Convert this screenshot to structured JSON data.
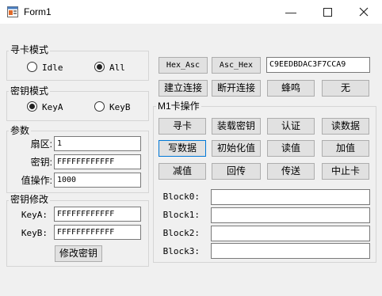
{
  "window": {
    "title": "Form1"
  },
  "search_mode": {
    "label": "寻卡模式",
    "options": [
      "Idle",
      "All"
    ],
    "selected": "All"
  },
  "key_mode": {
    "label": "密钥模式",
    "options": [
      "KeyA",
      "KeyB"
    ],
    "selected": "KeyA"
  },
  "params": {
    "label": "参数",
    "sector_label": "扇区:",
    "sector_value": "1",
    "key_label": "密钥:",
    "key_value": "FFFFFFFFFFFF",
    "valop_label": "值操作:",
    "valop_value": "1000"
  },
  "key_modify": {
    "label": "密钥修改",
    "keya_label": "KeyA:",
    "keya_value": "FFFFFFFFFFFF",
    "keyb_label": "KeyB:",
    "keyb_value": "FFFFFFFFFFFF",
    "modify_button": "修改密钥"
  },
  "top_buttons": {
    "hex_asc": "Hex_Asc",
    "asc_hex": "Asc_Hex",
    "convert_value": "C9EEDBDAC3F7CCA9"
  },
  "conn_buttons": {
    "connect": "建立连接",
    "disconnect": "断开连接",
    "beep": "蜂鸣",
    "none": "无"
  },
  "m1": {
    "label": "M1卡操作",
    "buttons": [
      "寻卡",
      "装载密钥",
      "认证",
      "读数据",
      "写数据",
      "初始化值",
      "读值",
      "加值",
      "减值",
      "回传",
      "传送",
      "中止卡"
    ],
    "blocks": [
      {
        "label": "Block0:",
        "value": ""
      },
      {
        "label": "Block1:",
        "value": ""
      },
      {
        "label": "Block2:",
        "value": ""
      },
      {
        "label": "Block3:",
        "value": ""
      }
    ]
  }
}
